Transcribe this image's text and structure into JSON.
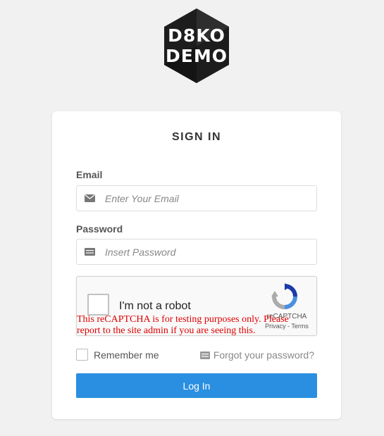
{
  "logo": {
    "line1": "D8KO",
    "line2": "DEMO"
  },
  "form": {
    "title": "SIGN IN",
    "email_label": "Email",
    "email_placeholder": "Enter Your Email",
    "email_icon": "envelope-icon",
    "password_label": "Password",
    "password_placeholder": "Insert Password",
    "password_icon": "keypad-icon",
    "remember_label": "Remember me",
    "forgot_label": "Forgot your password?",
    "forgot_icon": "card-icon",
    "login_label": "Log In",
    "login_color": "#2a8fe0"
  },
  "recaptcha": {
    "checkbox_label": "I'm not a robot",
    "brand": "reCAPTCHA",
    "links": "Privacy - Terms",
    "warning": "This reCAPTCHA is for testing purposes only. Please report to the site admin if you are seeing this.",
    "warning_color": "#e00000"
  }
}
